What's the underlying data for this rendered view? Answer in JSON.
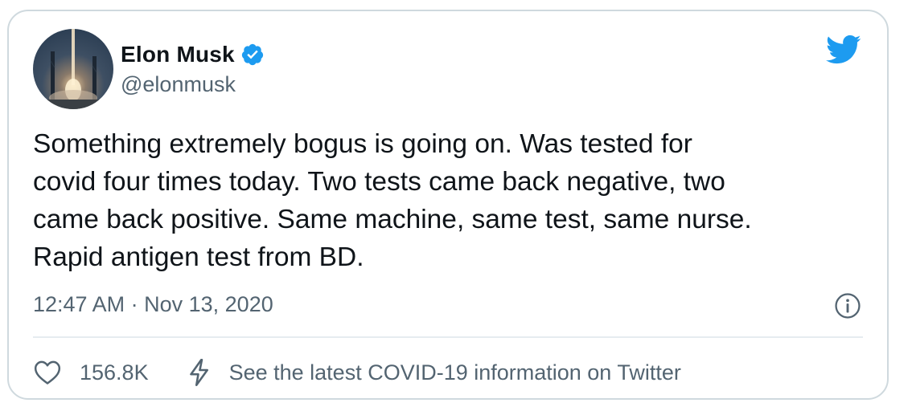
{
  "author": {
    "name": "Elon Musk",
    "handle": "@elonmusk",
    "verified": true
  },
  "tweet": {
    "text": "Something extremely bogus is going on. Was tested for\ncovid four times today. Two tests came back negative, two\ncame back positive. Same machine, same test, same nurse.\nRapid antigen test from BD.",
    "time": "12:47 AM",
    "separator": "·",
    "date": "Nov 13, 2020"
  },
  "actions": {
    "like_count": "156.8K",
    "covid_label": "See the latest COVID-19 information on Twitter"
  },
  "icons": {
    "logo": "twitter-bird-icon",
    "verified": "verified-badge-icon",
    "info": "info-icon",
    "like": "heart-icon",
    "covid": "lightning-bolt-icon"
  },
  "colors": {
    "brand_blue": "#1d9bf0",
    "text_primary": "#0f1419",
    "text_secondary": "#536471",
    "border": "#cfd9de"
  }
}
